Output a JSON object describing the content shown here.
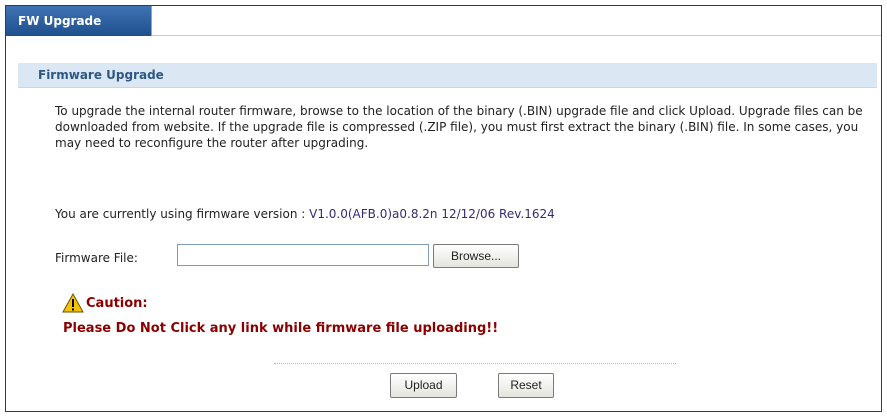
{
  "tabs": [
    {
      "label": "FW Upgrade"
    }
  ],
  "section": {
    "title": "Firmware Upgrade"
  },
  "description": "To upgrade the internal router firmware, browse to the location of the binary (.BIN) upgrade file and click Upload. Upgrade files can be downloaded from website. If the upgrade file is compressed (.ZIP file), you must first extract the binary (.BIN) file. In some cases, you may need to reconfigure the router after upgrading.",
  "version": {
    "label": "You are currently using firmware version : ",
    "value": "V1.0.0(AFB.0)a0.8.2n 12/12/06 Rev.1624"
  },
  "firmware_file": {
    "label": "Firmware File:",
    "value": "",
    "browse_label": "Browse..."
  },
  "caution": {
    "title": "Caution:",
    "message": "Please Do Not Click any link while firmware file uploading!!",
    "icon": "warning-icon"
  },
  "actions": {
    "upload_label": "Upload",
    "reset_label": "Reset"
  },
  "colors": {
    "tab_bg": "#2a5c9a",
    "section_bg": "#dbe8f3",
    "section_text": "#2e5883",
    "caution_text": "#8b0000",
    "version_text": "#3a2a73"
  }
}
